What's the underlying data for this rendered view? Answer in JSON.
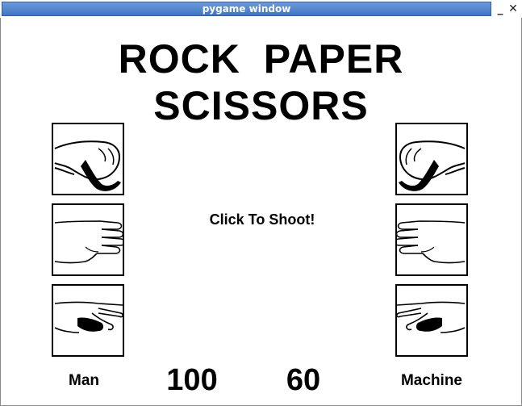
{
  "window": {
    "title": "pygame window",
    "minimize_icon": "minimize-icon",
    "close_icon": "close-icon"
  },
  "game": {
    "title": "ROCK  PAPER  SCISSORS",
    "prompt": "Click To Shoot!",
    "player": {
      "label": "Man",
      "score": "100",
      "choices": [
        "rock",
        "paper",
        "scissors"
      ]
    },
    "machine": {
      "label": "Machine",
      "score": "60",
      "choices": [
        "rock",
        "paper",
        "scissors"
      ]
    }
  }
}
